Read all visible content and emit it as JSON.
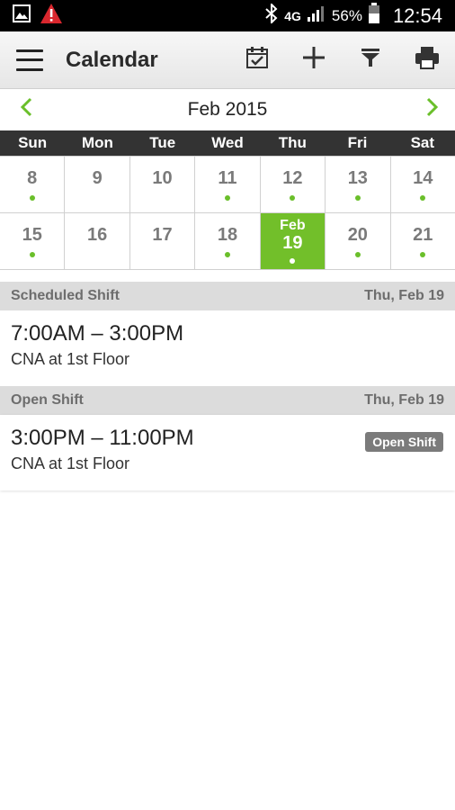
{
  "status_bar": {
    "icons_left": [
      "image-icon",
      "warning-icon"
    ],
    "icons_right": [
      "bluetooth-icon",
      "lte-icon",
      "signal-icon",
      "battery-icon"
    ],
    "network": "4G",
    "battery_percent": "56%",
    "time": "12:54"
  },
  "appbar": {
    "title": "Calendar",
    "actions": [
      "calendar-check-icon",
      "add-icon",
      "filter-icon",
      "print-icon"
    ]
  },
  "calendar": {
    "month_label": "Feb 2015",
    "weekdays": [
      "Sun",
      "Mon",
      "Tue",
      "Wed",
      "Thu",
      "Fri",
      "Sat"
    ],
    "week1": [
      {
        "day": "8",
        "dot": true
      },
      {
        "day": "9",
        "dot": false
      },
      {
        "day": "10",
        "dot": false
      },
      {
        "day": "11",
        "dot": true
      },
      {
        "day": "12",
        "dot": true
      },
      {
        "day": "13",
        "dot": true
      },
      {
        "day": "14",
        "dot": true
      }
    ],
    "week2": [
      {
        "day": "15",
        "dot": true
      },
      {
        "day": "16",
        "dot": false
      },
      {
        "day": "17",
        "dot": false
      },
      {
        "day": "18",
        "dot": true
      },
      {
        "day": "19",
        "dot": true,
        "selected": true,
        "month_label": "Feb"
      },
      {
        "day": "20",
        "dot": true
      },
      {
        "day": "21",
        "dot": true
      }
    ],
    "accent_color": "#72bf2a"
  },
  "shifts": [
    {
      "section": "Scheduled Shift",
      "date": "Thu, Feb 19",
      "time": "7:00AM – 3:00PM",
      "location": "CNA at 1st Floor",
      "badge": ""
    },
    {
      "section": "Open Shift",
      "date": "Thu, Feb 19",
      "time": "3:00PM – 11:00PM",
      "location": "CNA at 1st Floor",
      "badge": "Open Shift"
    }
  ]
}
